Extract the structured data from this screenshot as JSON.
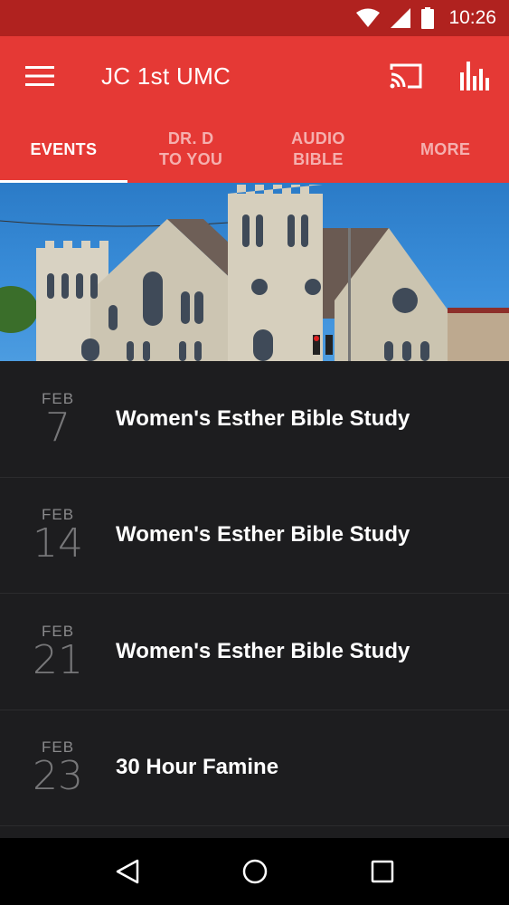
{
  "status_bar": {
    "time": "10:26"
  },
  "app_bar": {
    "title": "JC 1st UMC",
    "icons": [
      "menu-icon",
      "cast-icon",
      "bar-chart-icon"
    ]
  },
  "tabs": [
    {
      "label": "EVENTS",
      "active": true
    },
    {
      "label": "DR. D\nTO YOU",
      "active": false
    },
    {
      "label": "AUDIO\nBIBLE",
      "active": false
    },
    {
      "label": "MORE",
      "active": false
    }
  ],
  "events": [
    {
      "month": "FEB",
      "day": "7",
      "title": "Women's Esther Bible Study"
    },
    {
      "month": "FEB",
      "day": "14",
      "title": "Women's Esther Bible Study"
    },
    {
      "month": "FEB",
      "day": "21",
      "title": "Women's Esther Bible Study"
    },
    {
      "month": "FEB",
      "day": "23",
      "title": "30 Hour Famine"
    }
  ],
  "colors": {
    "status_bar": "#b0221f",
    "app_bar": "#e53935",
    "list_bg": "#1d1d1f",
    "nav_bar": "#000000"
  },
  "nav_icons": [
    "back-icon",
    "home-icon",
    "recents-icon"
  ]
}
